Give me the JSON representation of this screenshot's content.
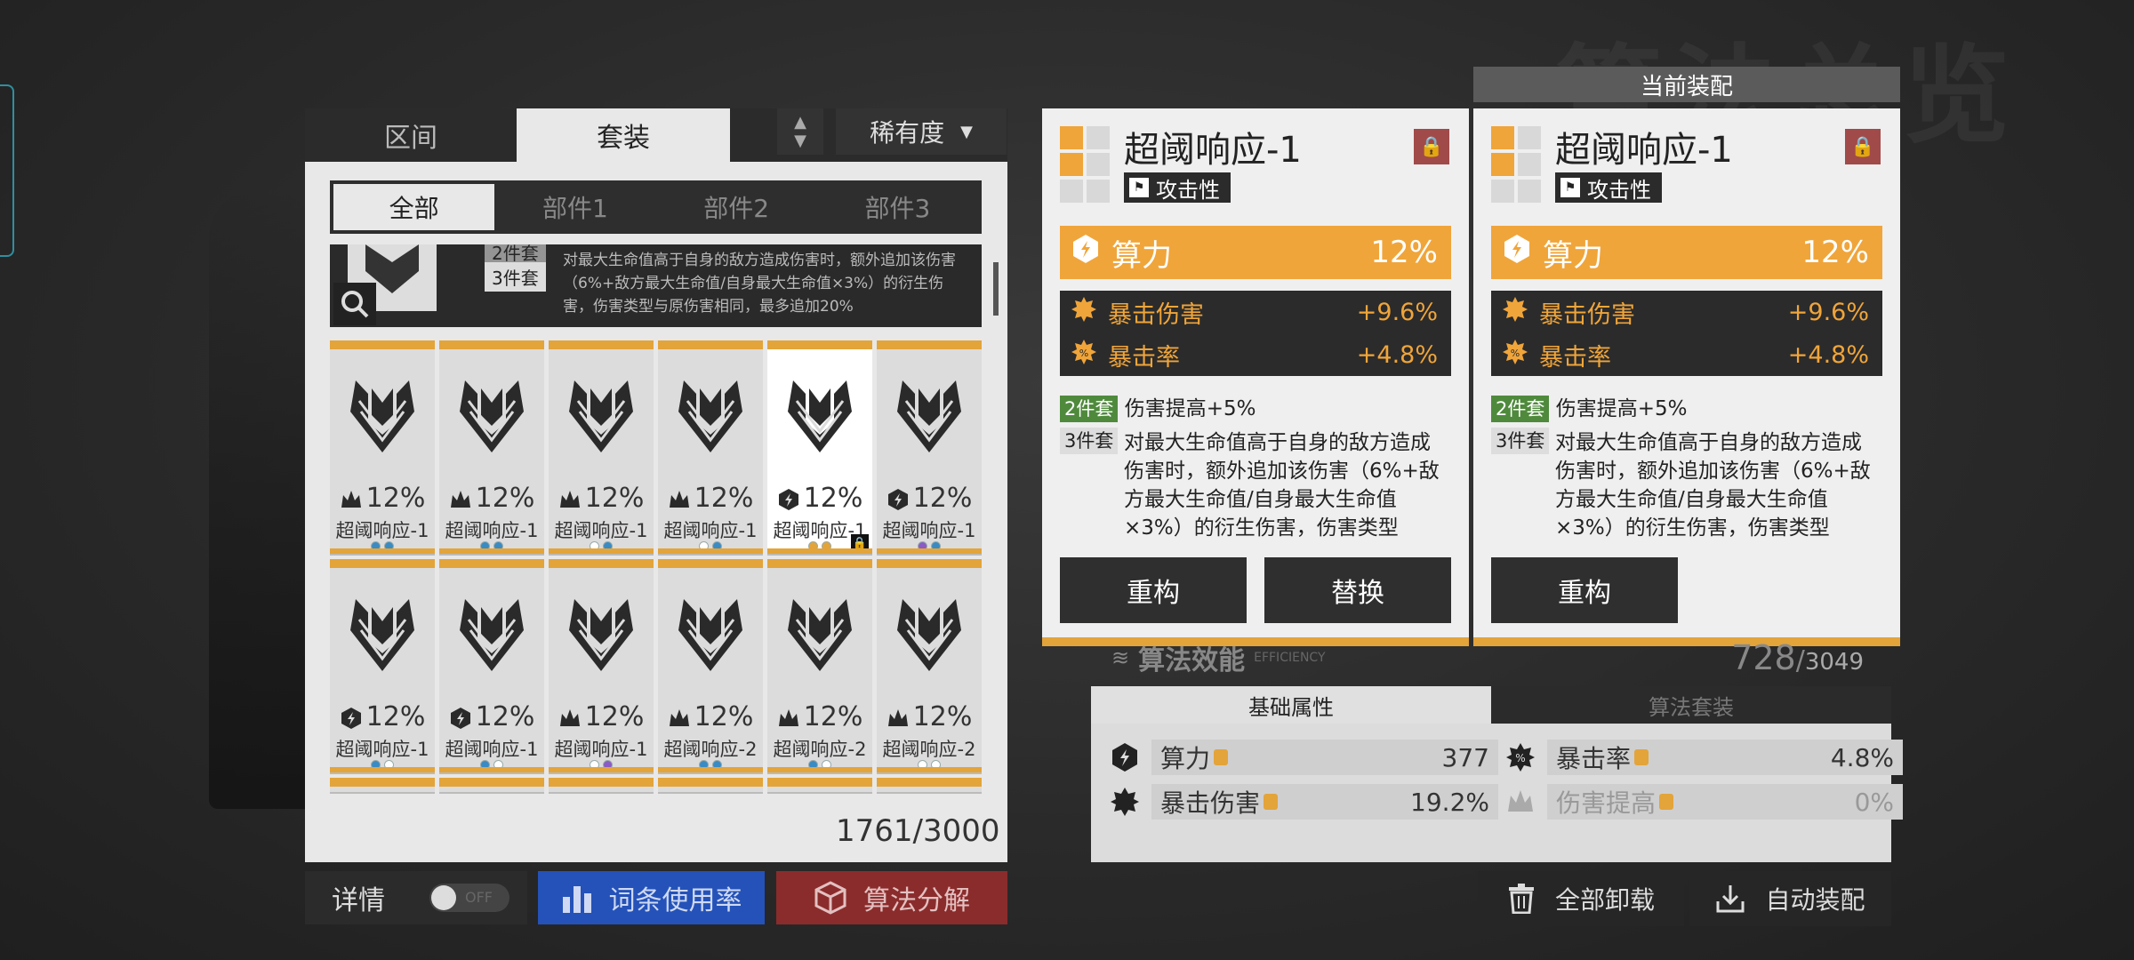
{
  "background": {
    "title": "算法总览"
  },
  "left_panel": {
    "tabs": [
      {
        "label": "区间"
      },
      {
        "label": "套装"
      }
    ],
    "rarity_label": "稀有度",
    "filters": [
      "全部",
      "部件1",
      "部件2",
      "部件3"
    ],
    "set_description": {
      "badge_top": "2件套",
      "badge": "3件套",
      "text": "对最大生命值高于自身的敌方造成伤害时，额外追加该伤害（6%+敌方最大生命值/自身最大生命值×3%）的衍生伤害，伤害类型与原伤害相同，最多追加20%"
    },
    "cards": [
      {
        "value": "12%",
        "name": "超阈响应-1",
        "icon": "crown-icon",
        "dots": [
          "#3a8bc4",
          "#3a8bc4"
        ]
      },
      {
        "value": "12%",
        "name": "超阈响应-1",
        "icon": "crown-icon",
        "dots": [
          "#3a8bc4",
          "#3a8bc4"
        ]
      },
      {
        "value": "12%",
        "name": "超阈响应-1",
        "icon": "crown-icon",
        "dots": [
          "#ffffff",
          "#3a8bc4"
        ]
      },
      {
        "value": "12%",
        "name": "超阈响应-1",
        "icon": "crown-icon",
        "dots": [
          "#ffffff",
          "#3a8bc4"
        ]
      },
      {
        "value": "12%",
        "name": "超阈响应-1",
        "icon": "power-icon",
        "dots": [
          "#e3a43a",
          "#e3a43a"
        ],
        "selected": true,
        "locked": true
      },
      {
        "value": "12%",
        "name": "超阈响应-1",
        "icon": "power-icon",
        "dots": [
          "#8a5cc4",
          "#3a8bc4"
        ]
      },
      {
        "value": "12%",
        "name": "超阈响应-1",
        "icon": "power-icon",
        "dots": [
          "#3a8bc4",
          "#ffffff"
        ]
      },
      {
        "value": "12%",
        "name": "超阈响应-1",
        "icon": "power-icon",
        "dots": [
          "#3a8bc4",
          "#ffffff"
        ]
      },
      {
        "value": "12%",
        "name": "超阈响应-1",
        "icon": "crown-icon",
        "dots": [
          "#ffffff",
          "#8a5cc4"
        ]
      },
      {
        "value": "12%",
        "name": "超阈响应-2",
        "icon": "crown-icon",
        "dots": [
          "#3a8bc4",
          "#3a8bc4"
        ]
      },
      {
        "value": "12%",
        "name": "超阈响应-2",
        "icon": "crown-icon",
        "dots": [
          "#3a8bc4",
          "#ffffff"
        ]
      },
      {
        "value": "12%",
        "name": "超阈响应-2",
        "icon": "crown-icon",
        "dots": [
          "#ffffff",
          "#ffffff"
        ]
      }
    ],
    "count": "1761/3000",
    "details_label": "详情",
    "toggle_label": "OFF",
    "usage_label": "词条使用率",
    "decompose_label": "算法分解"
  },
  "current_label": "当前装配",
  "detail_cards": [
    {
      "title": "超阈响应-1",
      "type": "攻击性",
      "main_stat": {
        "label": "算力",
        "value": "12%"
      },
      "sub_stats": [
        {
          "label": "暴击伤害",
          "value": "+9.6%"
        },
        {
          "label": "暴击率",
          "value": "+4.8%"
        }
      ],
      "set2_tag": "2件套",
      "set2_text": "伤害提高+5%",
      "set3_tag": "3件套",
      "set3_text": "对最大生命值高于自身的敌方造成伤害时，额外追加该伤害（6%+敌方最大生命值/自身最大生命值×3%）的衍生伤害，伤害类型",
      "buttons": [
        "重构",
        "替换"
      ]
    },
    {
      "title": "超阈响应-1",
      "type": "攻击性",
      "main_stat": {
        "label": "算力",
        "value": "12%"
      },
      "sub_stats": [
        {
          "label": "暴击伤害",
          "value": "+9.6%"
        },
        {
          "label": "暴击率",
          "value": "+4.8%"
        }
      ],
      "set2_tag": "2件套",
      "set2_text": "伤害提高+5%",
      "set3_tag": "3件套",
      "set3_text": "对最大生命值高于自身的敌方造成伤害时，额外追加该伤害（6%+敌方最大生命值/自身最大生命值×3%）的衍生伤害，伤害类型",
      "buttons": [
        "重构"
      ]
    }
  ],
  "efficiency": {
    "label": "算法效能",
    "sub": "EFFICIENCY",
    "value": "728",
    "max": "3049"
  },
  "stats": {
    "tabs": [
      "基础属性",
      "算法套装"
    ],
    "rows": [
      {
        "label": "算力",
        "value": "377"
      },
      {
        "label": "暴击率",
        "value": "4.8%"
      },
      {
        "label": "暴击伤害",
        "value": "19.2%"
      },
      {
        "label": "伤害提高",
        "value": "0%"
      }
    ]
  },
  "unload_label": "全部卸载",
  "auto_label": "自动装配",
  "colors": {
    "accent": "#e3a43a",
    "orange": "#f0a53a",
    "lock": "#a14a4a",
    "blue": "#2452b8",
    "red": "#8b2c2c"
  }
}
